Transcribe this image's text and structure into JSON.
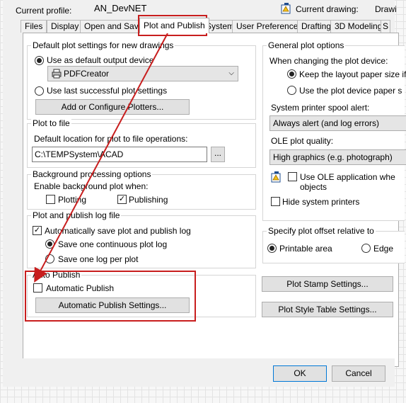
{
  "header": {
    "current_profile_label": "Current profile:",
    "current_profile_value": "AN_DevNET",
    "current_drawing_label": "Current drawing:",
    "current_drawing_value": "Drawi"
  },
  "tabs": [
    {
      "label": "Files"
    },
    {
      "label": "Display"
    },
    {
      "label": "Open and Save"
    },
    {
      "label": "Plot and Publish"
    },
    {
      "label": "System"
    },
    {
      "label": "User Preferences"
    },
    {
      "label": "Drafting"
    },
    {
      "label": "3D Modeling"
    },
    {
      "label": "S"
    }
  ],
  "default_plot": {
    "title": "Default plot settings for new drawings",
    "use_default_device": "Use as default output device",
    "device_value": "PDFCreator",
    "use_last_successful": "Use last successful plot settings",
    "add_configure_button": "Add or Configure Plotters..."
  },
  "plot_to_file": {
    "title": "Plot to file",
    "default_location_label": "Default location for plot to file operations:",
    "path_value": "C:\\TEMPSystem\\ACAD",
    "browse_button": "..."
  },
  "background": {
    "title": "Background processing options",
    "enable_label": "Enable background plot when:",
    "plotting": "Plotting",
    "publishing": "Publishing"
  },
  "log": {
    "title": "Plot and publish log file",
    "auto_save": "Automatically save plot and publish log",
    "continuous": "Save one continuous plot log",
    "per_plot": "Save one log per plot"
  },
  "auto_publish": {
    "title": "Auto Publish",
    "checkbox": "Automatic Publish",
    "settings_button": "Automatic Publish Settings..."
  },
  "general": {
    "title": "General plot options",
    "when_changing": "When changing the plot device:",
    "keep_layout": "Keep the layout paper size if",
    "use_device_paper": "Use the plot device paper s",
    "spool_label": "System printer spool alert:",
    "spool_value": "Always alert (and log errors)",
    "ole_quality_label": "OLE plot quality:",
    "ole_quality_value": "High graphics (e.g. photograph)",
    "use_ole_line1": "Use OLE application whe",
    "use_ole_line2": "objects",
    "hide_printers": "Hide system printers"
  },
  "offset": {
    "title": "Specify plot offset relative to",
    "printable": "Printable area",
    "edge": "Edge"
  },
  "buttons": {
    "plot_stamp": "Plot Stamp Settings...",
    "plot_style": "Plot Style Table Settings...",
    "ok": "OK",
    "cancel": "Cancel"
  },
  "colors": {
    "annotation_red": "#c81e1e",
    "dialog_bg": "#f0f0f0"
  }
}
